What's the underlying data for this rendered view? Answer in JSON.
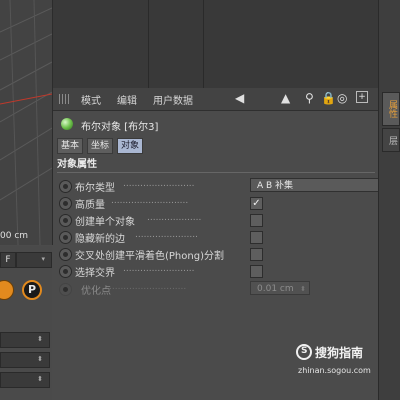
{
  "viewport": {
    "readout": "00 cm"
  },
  "left_panel": {
    "field_letter": "F",
    "p_button": "P"
  },
  "menubar": {
    "items": [
      "模式",
      "编辑",
      "用户数据"
    ],
    "icons": [
      "arrow-left-icon",
      "cursor-icon",
      "search-icon",
      "lock-icon",
      "target-icon",
      "new-window-icon"
    ]
  },
  "object": {
    "title": "布尔对象 [布尔3]"
  },
  "tabs": [
    "基本",
    "坐标",
    "对象"
  ],
  "active_tab": "对象",
  "section": {
    "title": "对象属性"
  },
  "properties": {
    "bool_type": {
      "label": "布尔类型",
      "value": "A B 补集"
    },
    "high_quality": {
      "label": "高质量",
      "checked": true
    },
    "single_object": {
      "label": "创建单个对象",
      "checked": false
    },
    "hide_new_edges": {
      "label": "隐藏新的边",
      "checked": false
    },
    "phong_break": {
      "label": "交叉处创建平滑着色(Phong)分割",
      "checked": false
    },
    "select_intersection": {
      "label": "选择交界",
      "checked": false
    },
    "optimize_points": {
      "label": "优化点",
      "value": "0.01 cm",
      "enabled": false
    }
  },
  "right_tabs": [
    "属性",
    "层"
  ],
  "watermark": {
    "brand": "搜狗指南",
    "url": "zhinan.sogou.com"
  },
  "colors": {
    "accent": "#e28a1e",
    "active_tab": "#aab7d2",
    "panel_bg": "#4b4b4b",
    "viewport_axis": "#c0392b"
  }
}
